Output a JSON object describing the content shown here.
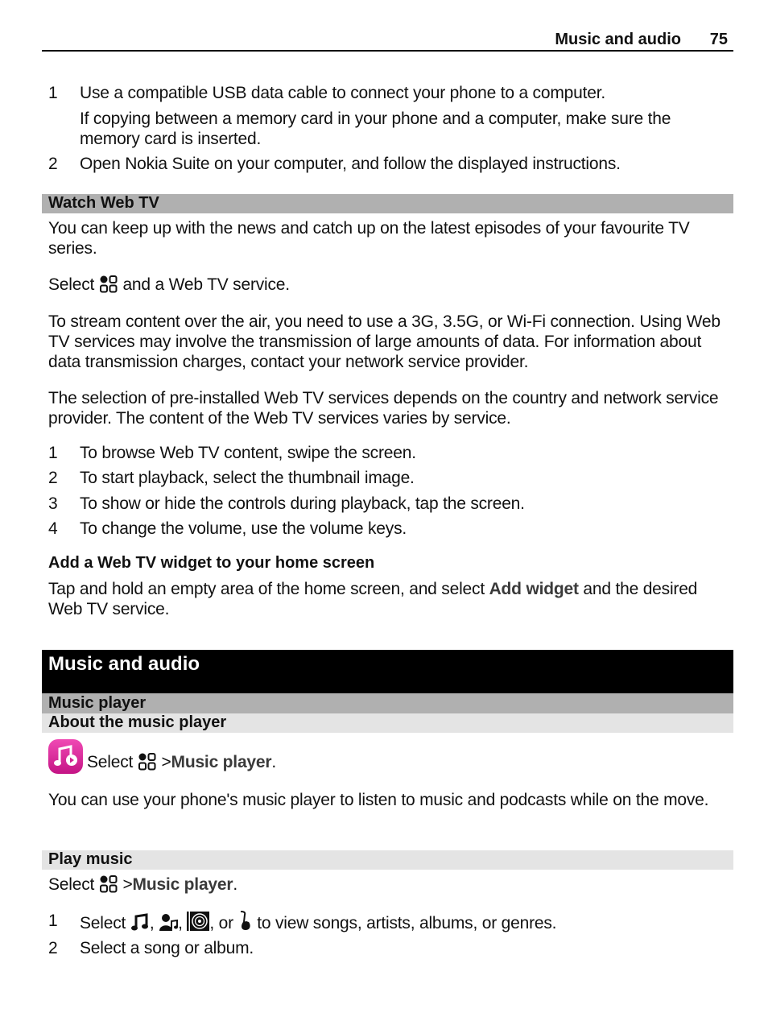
{
  "header": {
    "section": "Music and audio",
    "page_number": "75"
  },
  "intro_steps": [
    {
      "num": "1",
      "text": "Use a compatible USB data cable to connect your phone to a computer."
    },
    {
      "num": "",
      "text": "If copying between a memory card in your phone and a computer, make sure the memory card is inserted."
    },
    {
      "num": "2",
      "text": "Open Nokia Suite on your computer, and follow the displayed instructions."
    }
  ],
  "watch_web_tv": {
    "heading": "Watch Web TV",
    "p1": "You can keep up with the news and catch up on the latest episodes of your favourite TV series.",
    "select_prefix": "Select",
    "select_suffix": "and a Web TV service.",
    "p3": "To stream content over the air, you need to use a 3G, 3.5G, or Wi-Fi connection. Using Web TV services may involve the transmission of large amounts of data. For information about data transmission charges, contact your network service provider.",
    "p4": "The selection of pre-installed Web TV services depends on the country and network service provider. The content of the Web TV services varies by service.",
    "steps": [
      {
        "num": "1",
        "text": "To browse Web TV content, swipe the screen."
      },
      {
        "num": "2",
        "text": "To start playback, select the thumbnail image."
      },
      {
        "num": "3",
        "text": "To show or hide the controls during playback, tap the screen."
      },
      {
        "num": "4",
        "text": "To change the volume, use the volume keys."
      }
    ],
    "widget_heading": "Add a Web TV widget to your home screen",
    "widget_text_prefix": "Tap and hold an empty area of the home screen, and select",
    "widget_term": "Add widget",
    "widget_text_suffix": "and the desired Web TV service."
  },
  "music_and_audio": {
    "chapter_title": "Music and audio",
    "music_player_heading": "Music player",
    "about_heading": "About the music player",
    "about_select_prefix": "Select",
    "about_select_sep": ">",
    "about_select_term": "Music player",
    "about_select_end": ".",
    "about_text": "You can use your phone's music player to listen to music and podcasts while on the move.",
    "play_heading": "Play music",
    "play_select_prefix": "Select",
    "play_select_sep": ">",
    "play_select_term": "Music player",
    "play_select_end": ".",
    "play_steps": [
      {
        "num": "1",
        "prefix": "Select",
        "c1": ",",
        "c2": ",",
        "or": ", or",
        "suffix": "to view songs, artists, albums, or genres."
      },
      {
        "num": "2",
        "text": "Select a song or album."
      }
    ],
    "icons": {
      "menu": "menu-grid-icon",
      "app": "music-player-app-icon",
      "songs": "songs-icon",
      "artists": "artists-icon",
      "albums": "albums-icon",
      "genres": "genres-icon"
    },
    "app_icon_color": "#e0289a"
  }
}
